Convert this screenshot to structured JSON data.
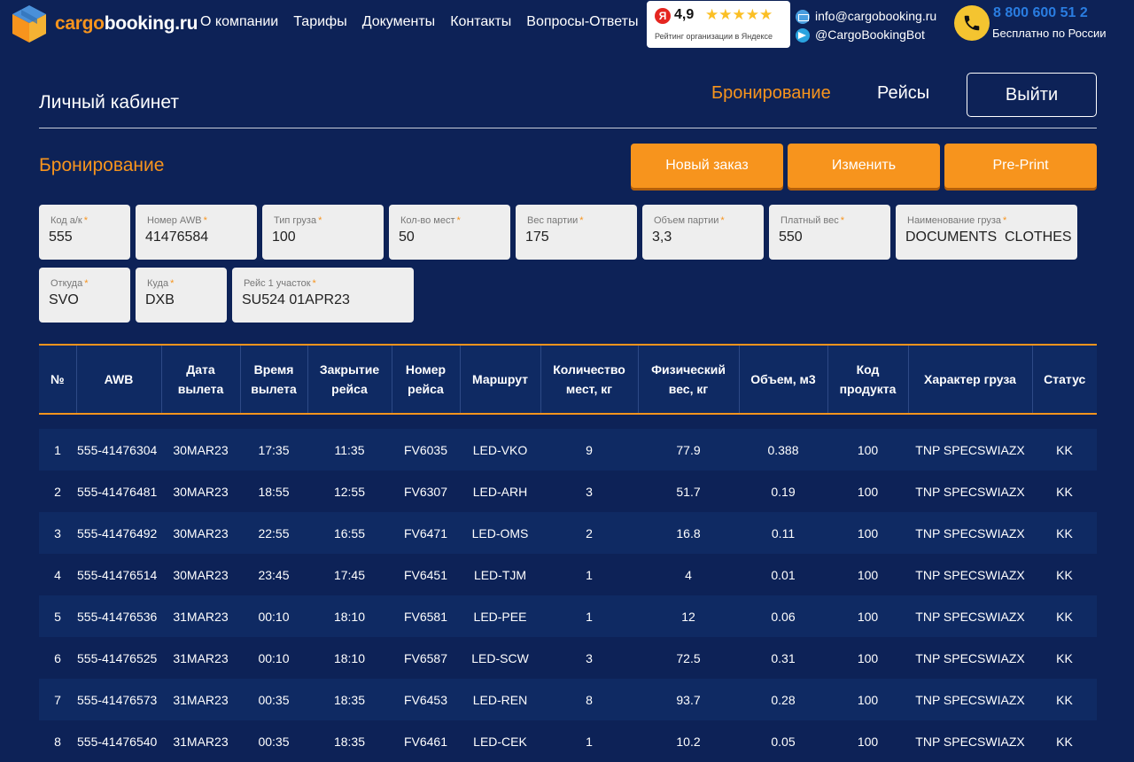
{
  "brand": {
    "name_part1": "cargo",
    "name_part2": "booking.ru"
  },
  "nav": [
    "О компании",
    "Тарифы",
    "Документы",
    "Контакты",
    "Вопросы-Ответы"
  ],
  "rating": {
    "badge": "Я",
    "score": "4,9",
    "stars": "★★★★★",
    "caption": "Рейтинг организации в Яндексе"
  },
  "contacts": {
    "email": "info@cargobooking.ru",
    "telegram": "@CargoBookingBot"
  },
  "phone": {
    "number": "8 800 600 51 2",
    "subtitle": "Бесплатно по России"
  },
  "cabinet": {
    "title": "Личный кабинет",
    "tab_booking": "Бронирование",
    "tab_flights": "Рейсы",
    "exit_label": "Выйти"
  },
  "section": {
    "title": "Бронирование",
    "new_order": "Новый заказ",
    "edit": "Изменить",
    "preprint": "Pre-Print"
  },
  "fields": {
    "airline_code": {
      "label": "Код а/к",
      "value": "555"
    },
    "awb_number": {
      "label": "Номер AWB",
      "value": "41476584"
    },
    "cargo_type": {
      "label": "Тип груза",
      "value": "100"
    },
    "pieces": {
      "label": "Кол-во мест",
      "value": "50"
    },
    "weight": {
      "label": "Вес партии",
      "value": "175"
    },
    "volume": {
      "label": "Объем партии",
      "value": "3,3"
    },
    "chargeable_weight": {
      "label": "Платный вес",
      "value": "550"
    },
    "cargo_name": {
      "label": "Наименование груза",
      "value": "DOCUMENTS  CLOTHES"
    },
    "origin": {
      "label": "Откуда",
      "value": "SVO"
    },
    "destination": {
      "label": "Куда",
      "value": "DXB"
    },
    "flight_leg1": {
      "label": "Рейс 1 участок",
      "value": "SU524 01APR23"
    },
    "required_mark": "*"
  },
  "table": {
    "headers": [
      "№",
      "AWB",
      "Дата вылета",
      "Время вылета",
      "Закрытие рейса",
      "Номер рейса",
      "Маршрут",
      "Количество мест, кг",
      "Физический вес, кг",
      "Объем, м3",
      "Код продукта",
      "Характер груза",
      "Статус"
    ],
    "rows": [
      [
        "1",
        "555-41476304",
        "30MAR23",
        "17:35",
        "11:35",
        "FV6035",
        "LED-VKO",
        "9",
        "77.9",
        "0.388",
        "100",
        "TNP SPECSWIAZX",
        "KK"
      ],
      [
        "2",
        "555-41476481",
        "30MAR23",
        "18:55",
        "12:55",
        "FV6307",
        "LED-ARH",
        "3",
        "51.7",
        "0.19",
        "100",
        "TNP SPECSWIAZX",
        "KK"
      ],
      [
        "3",
        "555-41476492",
        "30MAR23",
        "22:55",
        "16:55",
        "FV6471",
        "LED-OMS",
        "2",
        "16.8",
        "0.11",
        "100",
        "TNP SPECSWIAZX",
        "KK"
      ],
      [
        "4",
        "555-41476514",
        "30MAR23",
        "23:45",
        "17:45",
        "FV6451",
        "LED-TJM",
        "1",
        "4",
        "0.01",
        "100",
        "TNP SPECSWIAZX",
        "KK"
      ],
      [
        "5",
        "555-41476536",
        "31MAR23",
        "00:10",
        "18:10",
        "FV6581",
        "LED-PEE",
        "1",
        "12",
        "0.06",
        "100",
        "TNP SPECSWIAZX",
        "KK"
      ],
      [
        "6",
        "555-41476525",
        "31MAR23",
        "00:10",
        "18:10",
        "FV6587",
        "LED-SCW",
        "3",
        "72.5",
        "0.31",
        "100",
        "TNP SPECSWIAZX",
        "KK"
      ],
      [
        "7",
        "555-41476573",
        "31MAR23",
        "00:35",
        "18:35",
        "FV6453",
        "LED-REN",
        "8",
        "93.7",
        "0.28",
        "100",
        "TNP SPECSWIAZX",
        "KK"
      ],
      [
        "8",
        "555-41476540",
        "31MAR23",
        "00:35",
        "18:35",
        "FV6461",
        "LED-CEK",
        "1",
        "10.2",
        "0.05",
        "100",
        "TNP SPECSWIAZX",
        "KK"
      ]
    ]
  },
  "colors": {
    "background": "#0d2257",
    "accent": "#f7941d",
    "phone": "#2a7de1",
    "rating_star": "#fbbf24"
  }
}
